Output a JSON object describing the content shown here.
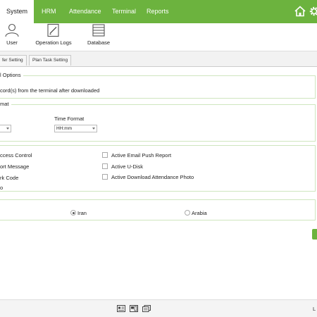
{
  "nav": {
    "tabs": [
      {
        "label": "System",
        "active": true
      },
      {
        "label": "HRM"
      },
      {
        "label": "Attendance"
      },
      {
        "label": "Terminal"
      },
      {
        "label": "Reports"
      }
    ],
    "icons": [
      "home-icon",
      "gear-icon"
    ],
    "accent_color": "#6cb33e"
  },
  "ribbon": {
    "buttons": [
      {
        "label": "User",
        "icon": "user-icon"
      },
      {
        "label": "Operation Logs",
        "icon": "operation-logs-icon"
      },
      {
        "label": "Database",
        "icon": "database-icon"
      }
    ]
  },
  "subtabs": [
    "fer Setting",
    "Plan Task Setting"
  ],
  "sections": {
    "download": {
      "legend": "l Options",
      "text": "cord(s) from the terminal after downloaded"
    },
    "format": {
      "legend": "mat",
      "time_format_label": "Time Format",
      "time_format_value": "HH:mm"
    },
    "options": {
      "left": [
        "ccess Control",
        "ort Message",
        "rk Code",
        "o"
      ],
      "right": [
        {
          "label": "Active Email Push Report",
          "checked": false
        },
        {
          "label": "Active U-Disk",
          "checked": false
        },
        {
          "label": "Active Download Attendance Photo",
          "checked": false
        }
      ]
    },
    "region": {
      "options": [
        {
          "label": "Iran",
          "selected": true
        },
        {
          "label": "Arabia",
          "selected": false
        }
      ]
    }
  },
  "statusbar": {
    "icons": [
      "id-card-icon",
      "terminal-device-icon",
      "copy-icon"
    ],
    "text": "L"
  }
}
